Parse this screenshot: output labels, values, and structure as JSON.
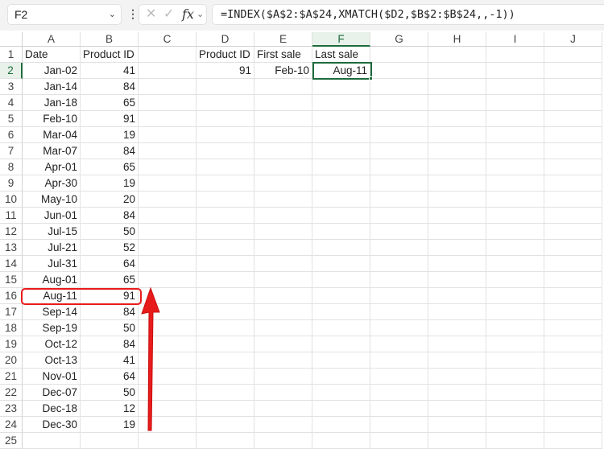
{
  "name_box": "F2",
  "formula": "=INDEX($A$2:$A$24,XMATCH($D2,$B$2:$B$24,,-1))",
  "columns": [
    "A",
    "B",
    "C",
    "D",
    "E",
    "F",
    "G",
    "H",
    "I",
    "J"
  ],
  "selected_column": "F",
  "selected_row": 2,
  "headers": {
    "A": "Date",
    "B": "Product ID",
    "D": "Product ID",
    "E": "First sale",
    "F": "Last sale"
  },
  "lookup": {
    "D": "91",
    "E": "Feb-10",
    "F": "Aug-11"
  },
  "rows": [
    [
      "Jan-02",
      "41"
    ],
    [
      "Jan-14",
      "84"
    ],
    [
      "Jan-18",
      "65"
    ],
    [
      "Feb-10",
      "91"
    ],
    [
      "Mar-04",
      "19"
    ],
    [
      "Mar-07",
      "84"
    ],
    [
      "Apr-01",
      "65"
    ],
    [
      "Apr-30",
      "19"
    ],
    [
      "May-10",
      "20"
    ],
    [
      "Jun-01",
      "84"
    ],
    [
      "Jul-15",
      "50"
    ],
    [
      "Jul-21",
      "52"
    ],
    [
      "Jul-31",
      "64"
    ],
    [
      "Aug-01",
      "65"
    ],
    [
      "Aug-11",
      "91"
    ],
    [
      "Sep-14",
      "84"
    ],
    [
      "Sep-19",
      "50"
    ],
    [
      "Oct-12",
      "84"
    ],
    [
      "Oct-13",
      "41"
    ],
    [
      "Nov-01",
      "64"
    ],
    [
      "Dec-07",
      "50"
    ],
    [
      "Dec-18",
      "12"
    ],
    [
      "Dec-30",
      "19"
    ]
  ],
  "highlight_color": "#e81b1b",
  "accent": "#1e6b3c"
}
